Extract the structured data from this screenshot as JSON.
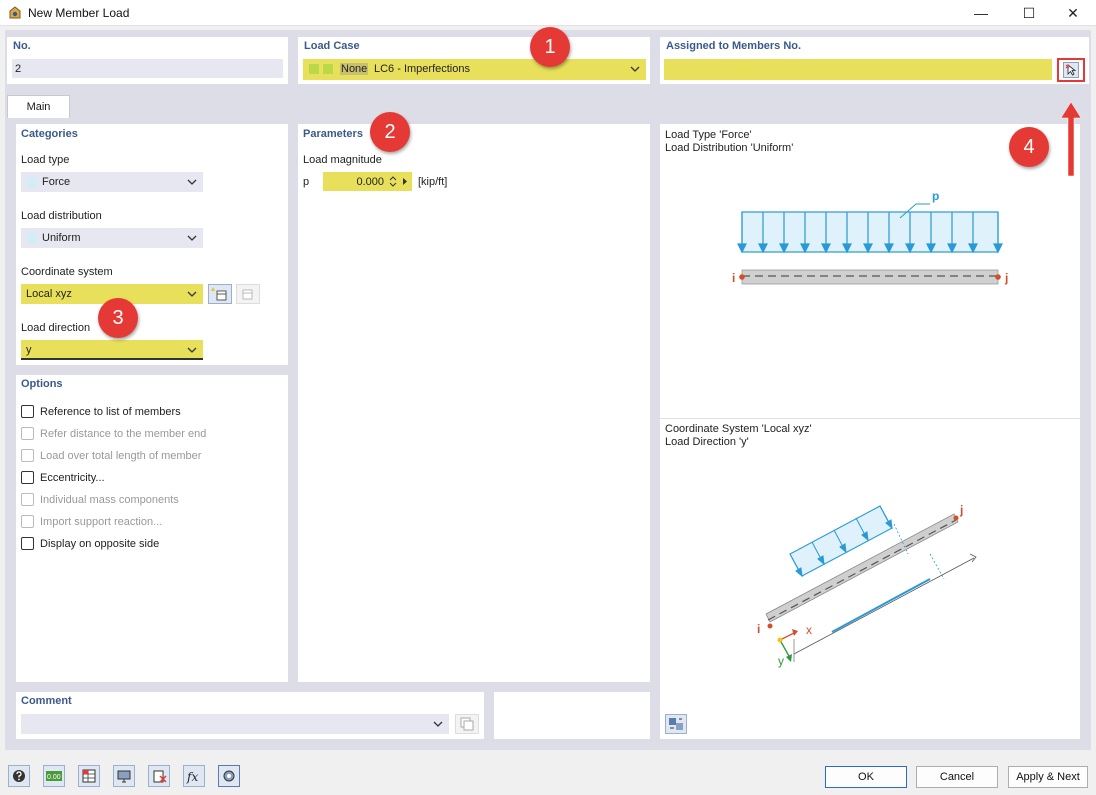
{
  "window": {
    "title": "New Member Load",
    "minimize": "—",
    "maximize": "☐",
    "close": "✕"
  },
  "no": {
    "header": "No.",
    "value": "2"
  },
  "load_case": {
    "header": "Load Case",
    "tag": "None",
    "value": "LC6 - Imperfections",
    "color": "#b9d84a"
  },
  "assigned": {
    "header": "Assigned to Members No.",
    "value": ""
  },
  "tabs": [
    {
      "label": "Main"
    }
  ],
  "categories": {
    "header": "Categories",
    "load_type": {
      "label": "Load type",
      "value": "Force"
    },
    "load_distribution": {
      "label": "Load distribution",
      "value": "Uniform"
    },
    "coordinate_system": {
      "label": "Coordinate system",
      "value": "Local xyz"
    },
    "load_direction": {
      "label": "Load direction",
      "value": "y"
    }
  },
  "parameters": {
    "header": "Parameters",
    "load_magnitude_label": "Load magnitude",
    "symbol": "p",
    "value": "0.000",
    "unit": "[kip/ft]"
  },
  "options": {
    "header": "Options",
    "items": [
      {
        "label": "Reference to list of members",
        "enabled": true,
        "checked": false
      },
      {
        "label": "Refer distance to the member end",
        "enabled": false,
        "checked": false
      },
      {
        "label": "Load over total length of member",
        "enabled": false,
        "checked": false
      },
      {
        "label": "Eccentricity...",
        "enabled": true,
        "checked": false
      },
      {
        "label": "Individual mass components",
        "enabled": false,
        "checked": false
      },
      {
        "label": "Import support reaction...",
        "enabled": false,
        "checked": false
      },
      {
        "label": "Display on opposite side",
        "enabled": true,
        "checked": false
      }
    ]
  },
  "preview": {
    "top_line1": "Load Type 'Force'",
    "top_line2": "Load Distribution 'Uniform'",
    "bottom_line1": "Coordinate System 'Local xyz'",
    "bottom_line2": "Load Direction 'y'",
    "p_label": "p",
    "i_label": "i",
    "j_label": "j",
    "x_label": "x",
    "y_label": "y"
  },
  "comment": {
    "header": "Comment",
    "value": ""
  },
  "badges": [
    "1",
    "2",
    "3",
    "4"
  ],
  "buttons": {
    "ok": "OK",
    "cancel": "Cancel",
    "apply_next": "Apply & Next"
  },
  "toolbar_icons": [
    "help-icon",
    "units-icon",
    "table-icon",
    "view-icon",
    "delete-icon",
    "formula-icon",
    "settings-icon"
  ],
  "colors": {
    "highlight": "#e8e05a",
    "accent": "#3a5a8c",
    "badge": "#e53935",
    "load_blue": "#2a9ad6"
  }
}
